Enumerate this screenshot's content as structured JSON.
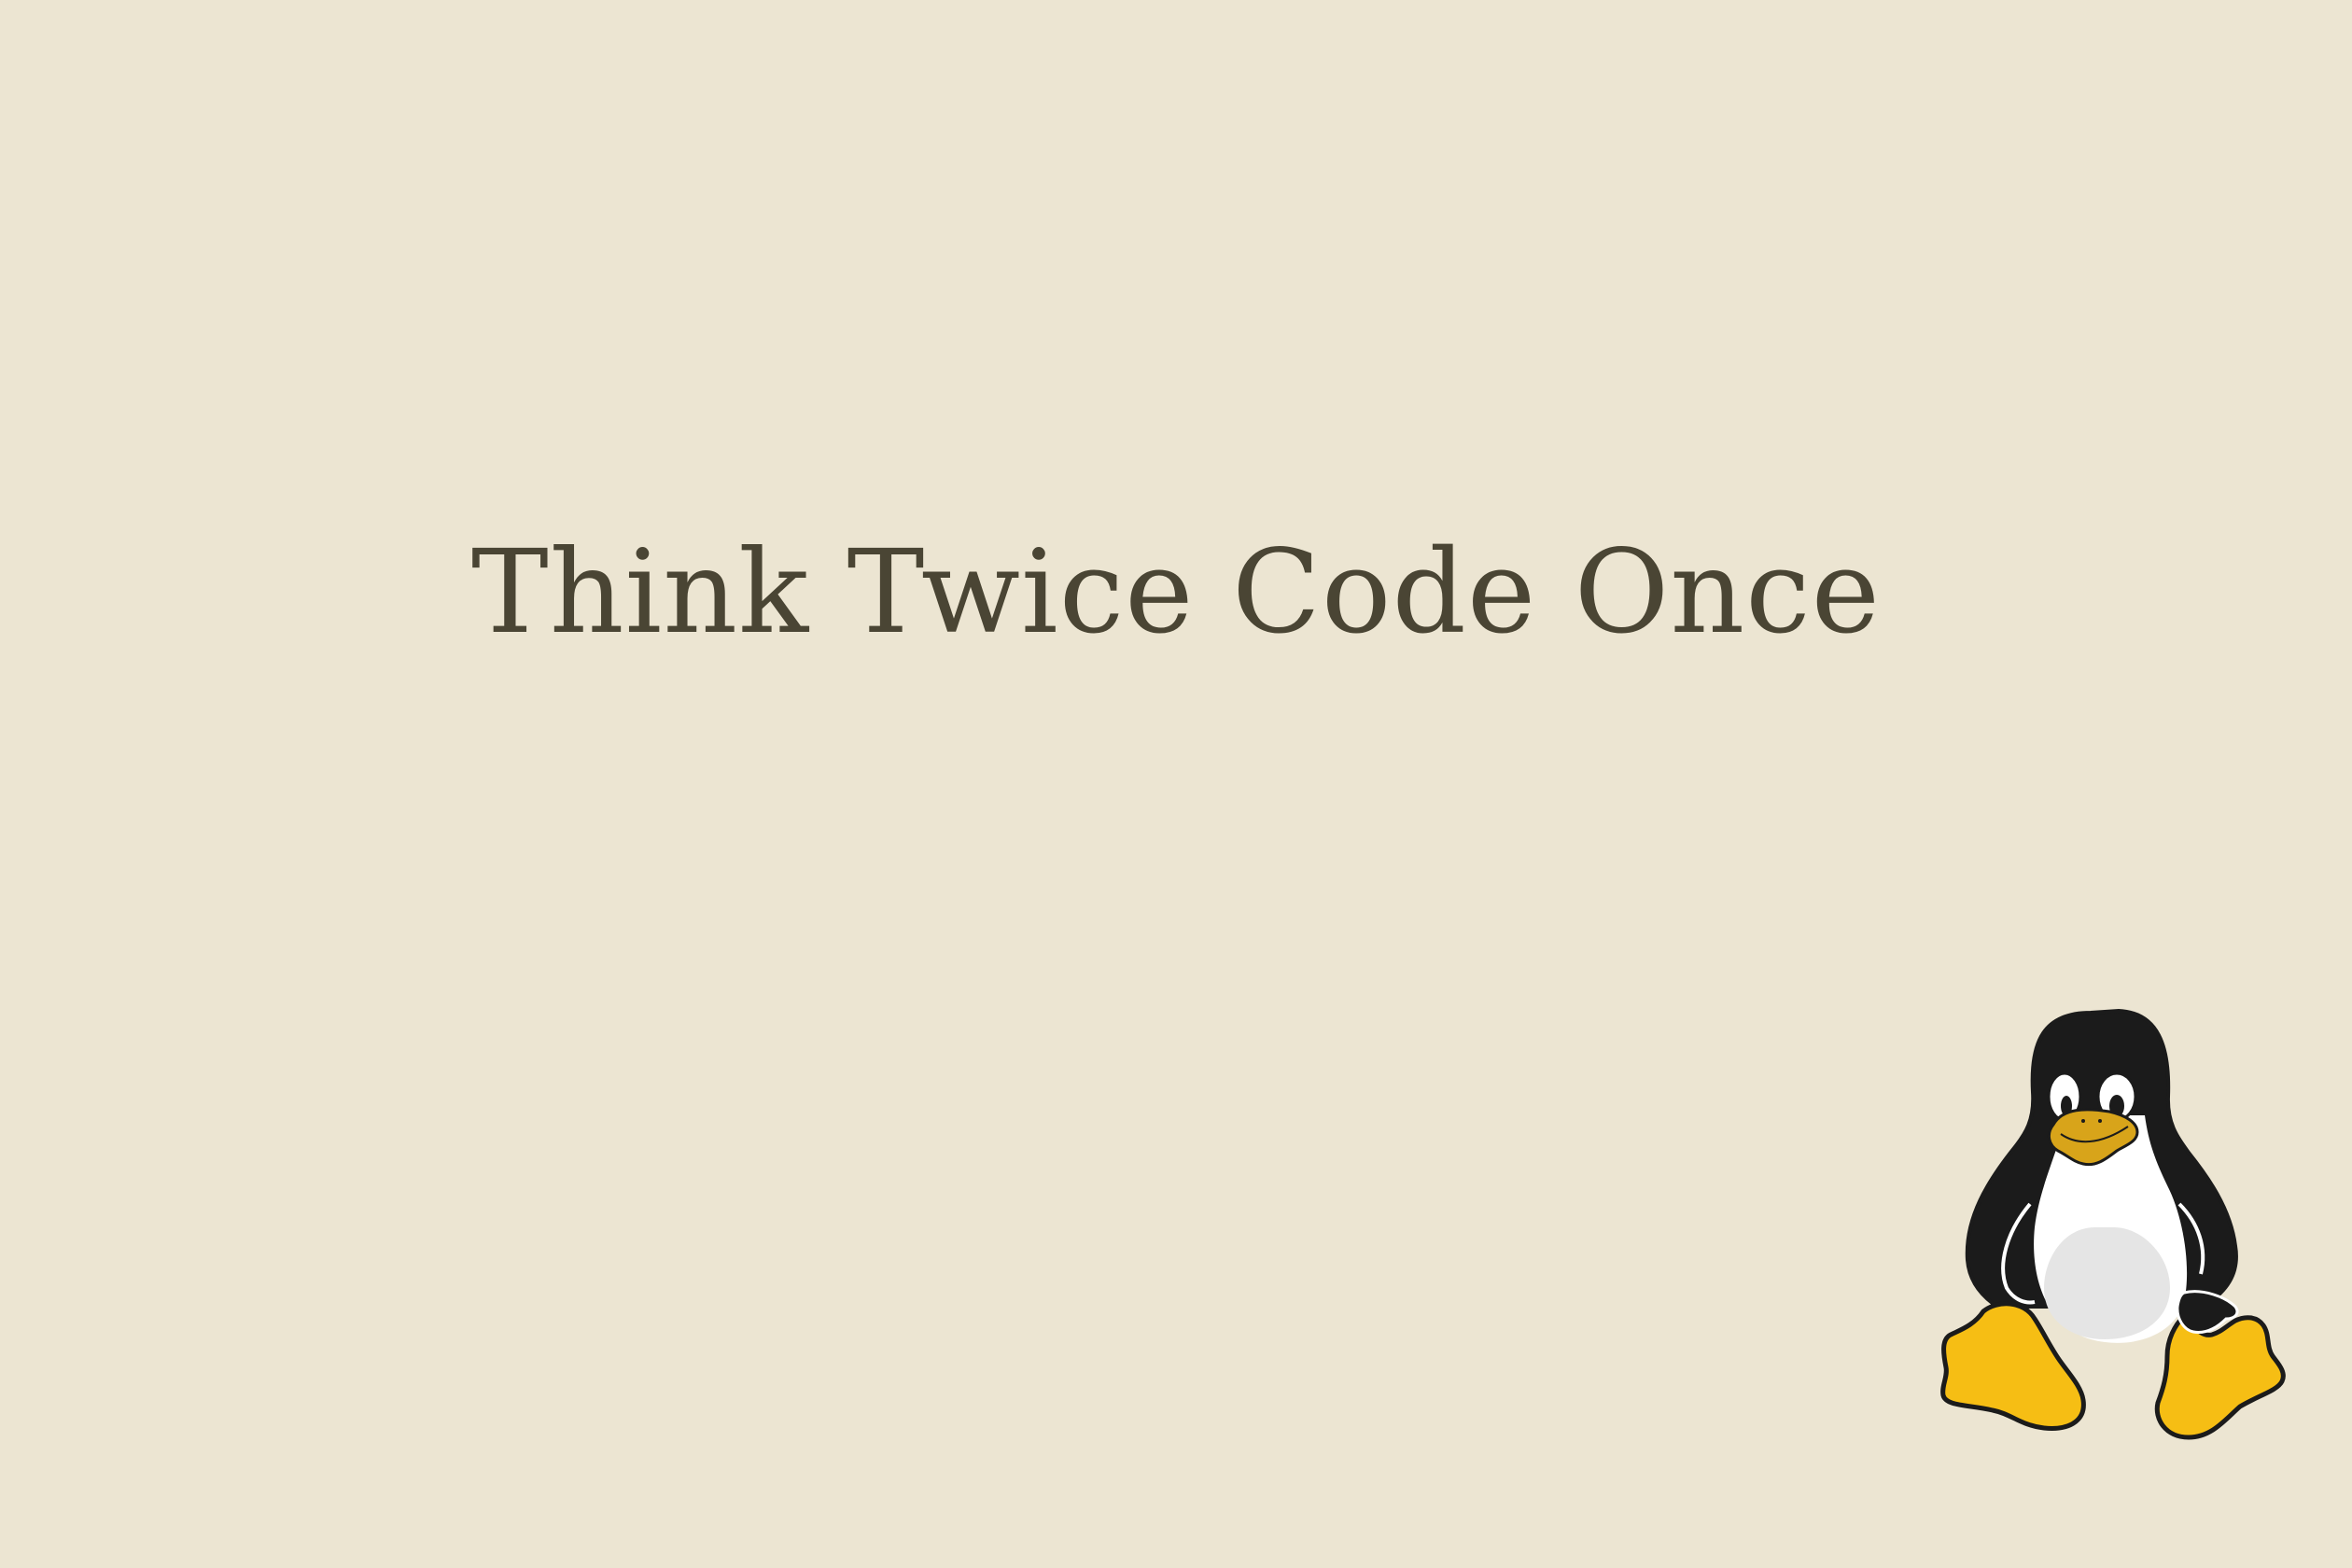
{
  "wallpaper": {
    "background_color": "#ECE5D2",
    "tagline": "Think Twice Code Once",
    "tagline_color": "#4A4534",
    "mascot_icon": "tux-penguin-icon"
  },
  "colors": {
    "tux_black": "#1B1B1B",
    "tux_white": "#FFFFFF",
    "tux_belly": "#E5E5E5",
    "tux_yellow": "#F6BE14",
    "tux_beak": "#D8A41A"
  }
}
